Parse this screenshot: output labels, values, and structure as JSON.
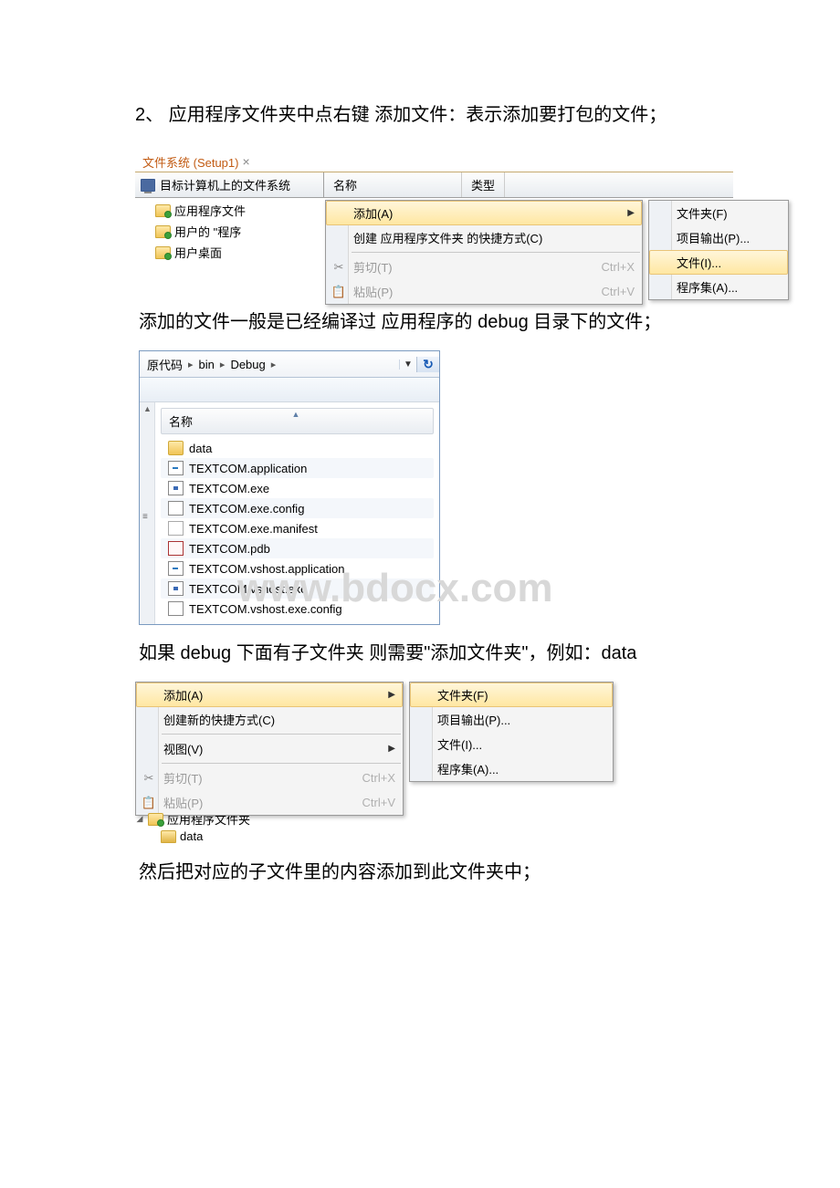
{
  "paragraphs": {
    "p1": "2、 应用程序文件夹中点右键 添加文件：表示添加要打包的文件；",
    "p2": "添加的文件一般是已经编译过 应用程序的 debug 目录下的文件；",
    "p3": "如果 debug 下面有子文件夹 则需要\"添加文件夹\"，例如：data",
    "p4": "然后把对应的子文件里的内容添加到此文件夹中；"
  },
  "watermark": "www.bdocx.com",
  "vs": {
    "tab": "文件系统 (Setup1)",
    "treeHead": "目标计算机上的文件系统",
    "columns": {
      "name": "名称",
      "type": "类型"
    },
    "tree": {
      "appFolder": "应用程序文件",
      "userProg": "用户的 \"程序",
      "userDesk": "用户桌面"
    },
    "menu1": {
      "add": "添加(A)",
      "shortcut": "创建 应用程序文件夹 的快捷方式(C)",
      "cut": "剪切(T)",
      "cutSc": "Ctrl+X",
      "paste": "粘贴(P)",
      "pasteSc": "Ctrl+V"
    },
    "submenu": {
      "folder": "文件夹(F)",
      "output": "项目输出(P)...",
      "file": "文件(I)...",
      "assembly": "程序集(A)..."
    }
  },
  "explorer": {
    "crumbs": [
      "原代码",
      "bin",
      "Debug"
    ],
    "nameHeader": "名称",
    "files": [
      {
        "label": "data",
        "icon": "folder"
      },
      {
        "label": "TEXTCOM.application",
        "icon": "app"
      },
      {
        "label": "TEXTCOM.exe",
        "icon": "exe"
      },
      {
        "label": "TEXTCOM.exe.config",
        "icon": "cfg"
      },
      {
        "label": "TEXTCOM.exe.manifest",
        "icon": "blank"
      },
      {
        "label": "TEXTCOM.pdb",
        "icon": "pdb"
      },
      {
        "label": "TEXTCOM.vshost.application",
        "icon": "app"
      },
      {
        "label": "TEXTCOM.vshost.exe",
        "icon": "exe"
      },
      {
        "label": "TEXTCOM.vshost.exe.config",
        "icon": "cfg"
      }
    ]
  },
  "menu2": {
    "add": "添加(A)",
    "shortcut": "创建新的快捷方式(C)",
    "view": "视图(V)",
    "cut": "剪切(T)",
    "cutSc": "Ctrl+X",
    "paste": "粘贴(P)",
    "pasteSc": "Ctrl+V"
  },
  "tree4": {
    "root": "应用程序文件夹",
    "child": "data"
  }
}
